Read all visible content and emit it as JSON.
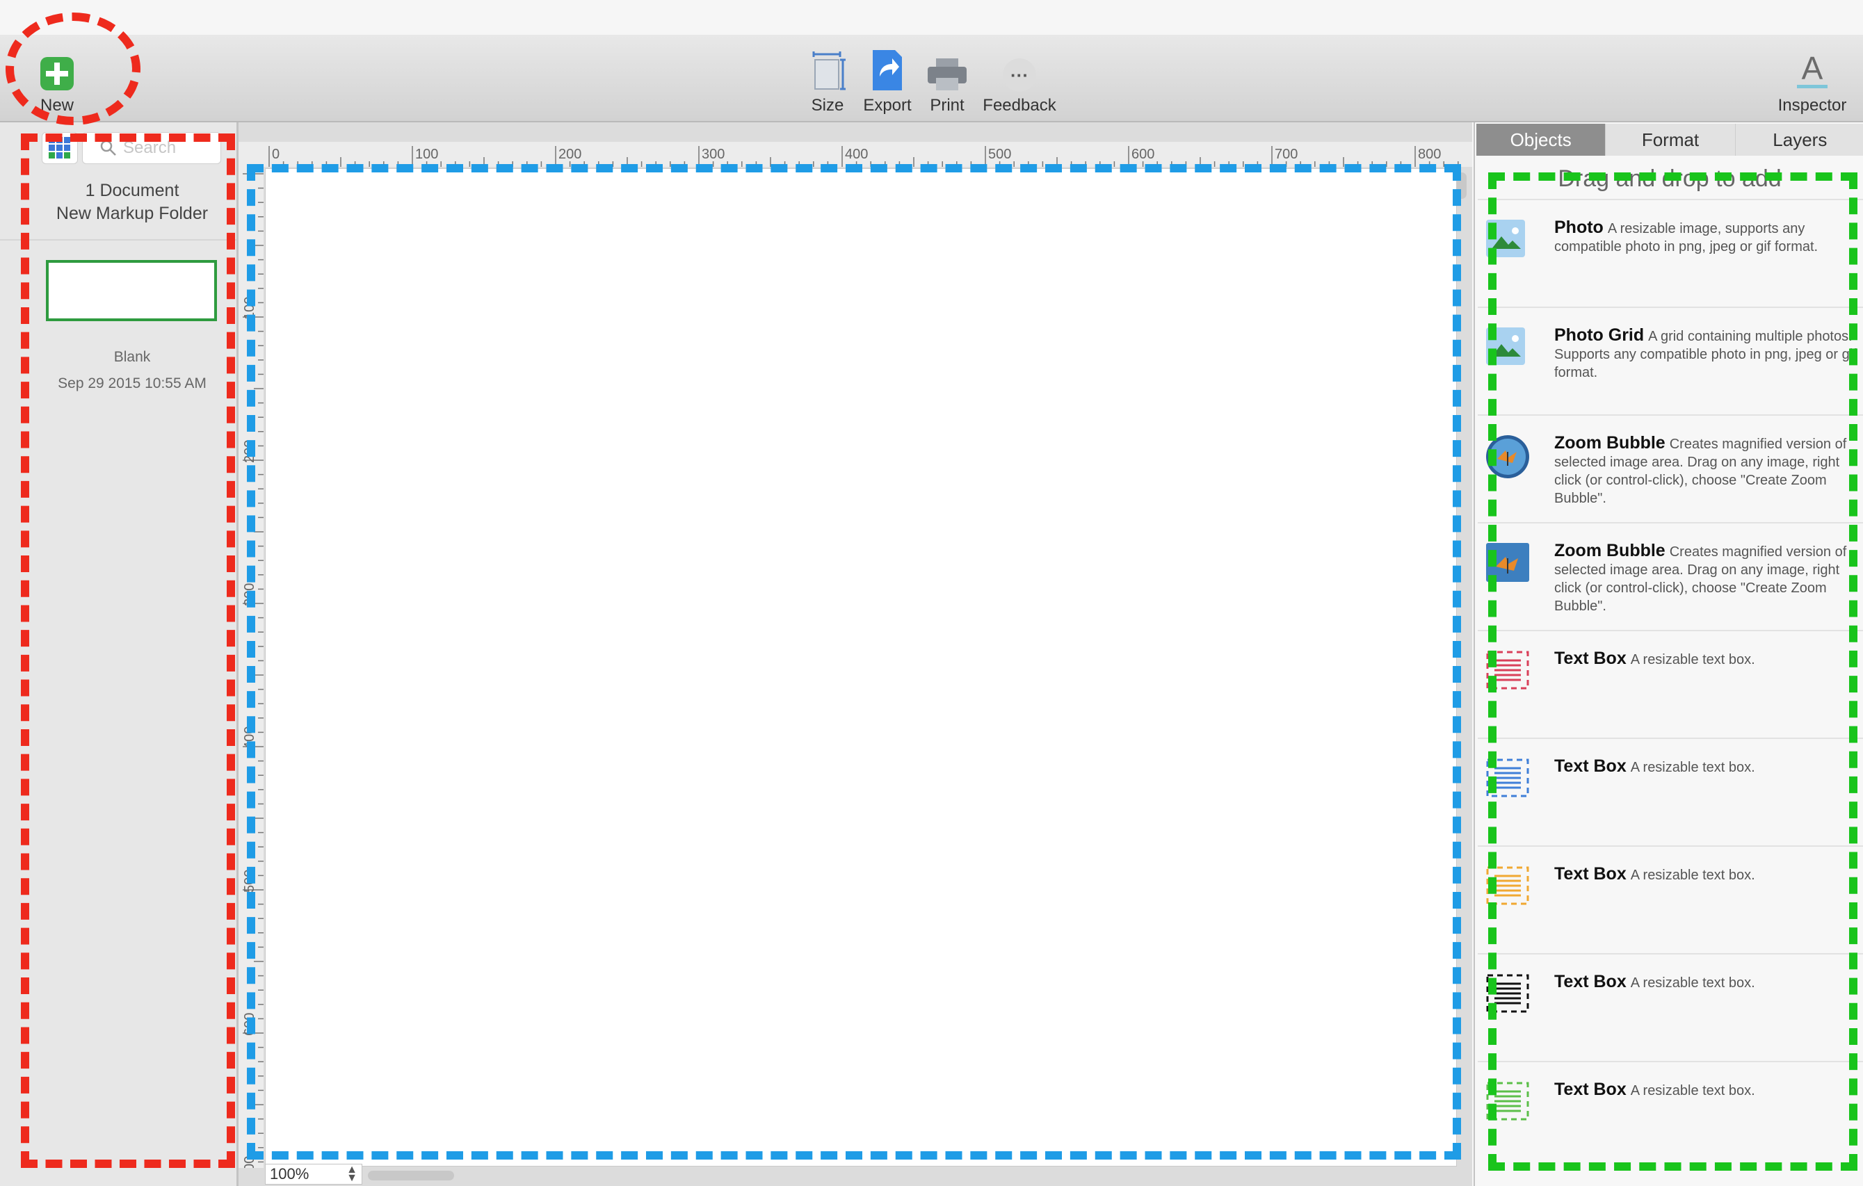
{
  "toolbar": {
    "new_label": "New",
    "size_label": "Size",
    "export_label": "Export",
    "print_label": "Print",
    "feedback_label": "Feedback",
    "inspector_label": "Inspector",
    "inspector_glyph": "A",
    "feedback_glyph": "···"
  },
  "sidebar": {
    "search_placeholder": "Search",
    "document_count": "1 Document",
    "folder_name": "New Markup Folder",
    "document": {
      "name": "Blank",
      "date": "Sep 29 2015 10:55 AM"
    }
  },
  "canvas": {
    "ruler_h_labels": [
      "0",
      "100",
      "200",
      "300",
      "400",
      "500",
      "600",
      "700",
      "800"
    ],
    "ruler_v_labels": [
      "100",
      "200",
      "300",
      "400",
      "500",
      "600",
      "700"
    ],
    "zoom": "100%"
  },
  "inspector": {
    "tabs": [
      {
        "label": "Objects",
        "active": true
      },
      {
        "label": "Format",
        "active": false
      },
      {
        "label": "Layers",
        "active": false
      }
    ],
    "hint": "Drag and drop to add",
    "objects": [
      {
        "title": "Photo",
        "desc": "A resizable image, supports any compatible photo in png, jpeg or gif format.",
        "icon": "photo-icon"
      },
      {
        "title": "Photo Grid",
        "desc": "A grid containing multiple photos.  Supports any compatible photo in png, jpeg or gif format.",
        "icon": "photo-grid-icon"
      },
      {
        "title": "Zoom Bubble",
        "desc": "Creates magnified version of selected image area. Drag on any image, right click (or control-click), choose \"Create Zoom Bubble\".",
        "icon": "zoom-bubble-round-icon"
      },
      {
        "title": "Zoom Bubble",
        "desc": "Creates magnified version of selected image area.  Drag on any image, right click (or control-click), choose \"Create Zoom Bubble\".",
        "icon": "zoom-bubble-square-icon"
      },
      {
        "title": "Text Box",
        "desc": "A resizable text box.",
        "icon": "text-box-red-icon",
        "color": "#d9405a"
      },
      {
        "title": "Text Box",
        "desc": "A resizable text box.",
        "icon": "text-box-blue-icon",
        "color": "#3f7fd8"
      },
      {
        "title": "Text Box",
        "desc": "A resizable text box.",
        "icon": "text-box-orange-icon",
        "color": "#f0a832"
      },
      {
        "title": "Text Box",
        "desc": "A resizable text box.",
        "icon": "text-box-black-icon",
        "color": "#111111"
      },
      {
        "title": "Text Box",
        "desc": "A resizable text box.",
        "icon": "text-box-green-icon",
        "color": "#5cbf4a"
      }
    ]
  },
  "annotation_colors": {
    "red": "#ee2a1d",
    "blue": "#1f9ce6",
    "green": "#19c41c"
  }
}
